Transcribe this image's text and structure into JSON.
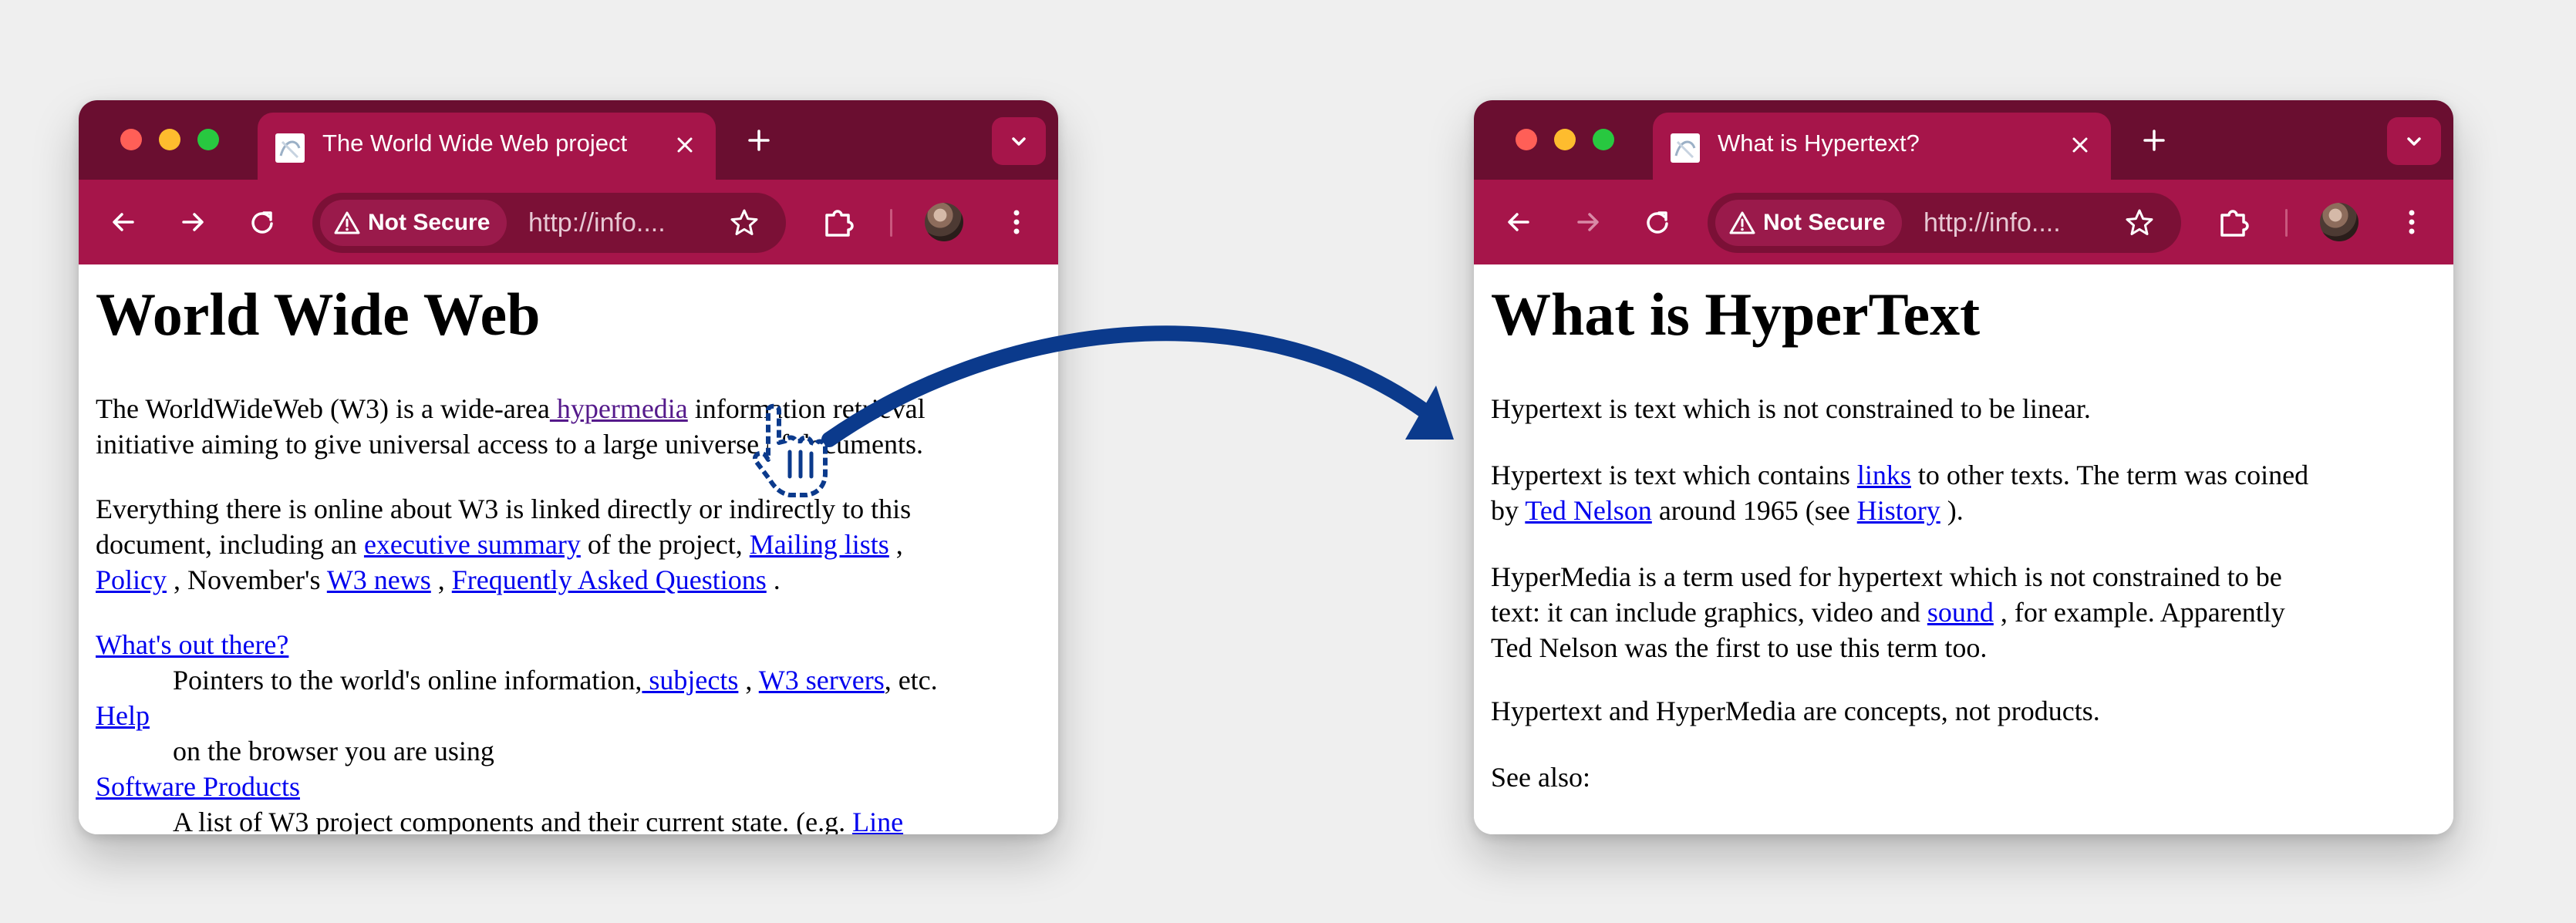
{
  "left_window": {
    "tab_title": "The World Wide Web project",
    "security_label": "Not Secure",
    "url": "http://info....",
    "heading": "World Wide Web",
    "p1": {
      "t1": "The WorldWideWeb (W3) is a wide-area",
      "link_hypermedia": " hypermedia",
      "t2": " information retrieval",
      "line2": "initiative aiming to give universal access to a large universe of documents."
    },
    "p2": {
      "line1": "Everything there is online about W3 is linked directly or indirectly to this",
      "t1": "document, including an ",
      "link_exec": "executive summary",
      "t2": " of the project, ",
      "link_mailing": "Mailing lists",
      "t3": " ,",
      "link_policy": "Policy",
      "t4": " , November's ",
      "link_news": "W3 news",
      "t5": " , ",
      "link_faq": "Frequently Asked Questions",
      "t6": " ."
    },
    "dl": {
      "link_whats": "What's out there?",
      "desc1_t1": "Pointers to the world's online information,",
      "link_subjects": " subjects",
      "desc1_t2": " , ",
      "link_servers": "W3 servers",
      "desc1_t3": ", etc.",
      "link_help": "Help",
      "desc2": "on the browser you are using",
      "link_software": "Software Products",
      "desc3_t1": "A list of W3 project components and their current state. (e.g. ",
      "link_line": "Line"
    }
  },
  "right_window": {
    "tab_title": "What is Hypertext?",
    "security_label": "Not Secure",
    "url": "http://info....",
    "heading": "What is HyperText",
    "p1": "Hypertext is text which is not constrained to be linear.",
    "p2": {
      "t1": "Hypertext is text which contains ",
      "link_links": "links",
      "t2": " to other texts. The term was coined",
      "t3": "by ",
      "link_ted": "Ted Nelson",
      "t4": " around 1965 (see ",
      "link_history": "History",
      "t5": " )."
    },
    "p3": {
      "line1": "HyperMedia is a term used for hypertext which is not constrained to be",
      "t1": "text: it can include graphics, video and ",
      "link_sound": "sound",
      "t2": " , for example. Apparently",
      "line3": "Ted Nelson was the first to use this term too."
    },
    "p4": "Hypertext and HyperMedia are concepts, not products.",
    "p5": "See also:"
  },
  "colors": {
    "tabbar_bg": "#6a0e30",
    "toolbar_bg": "#a6154a",
    "link": "#0000ee",
    "visited_link": "#551a8b",
    "arrow": "#0b3a8c"
  },
  "icons": [
    "close-icon",
    "plus-icon",
    "chevron-down-icon",
    "back-arrow-icon",
    "forward-arrow-icon",
    "reload-icon",
    "warning-icon",
    "star-icon",
    "extensions-icon",
    "more-menu-icon",
    "hand-cursor-icon",
    "curved-arrow-icon"
  ]
}
